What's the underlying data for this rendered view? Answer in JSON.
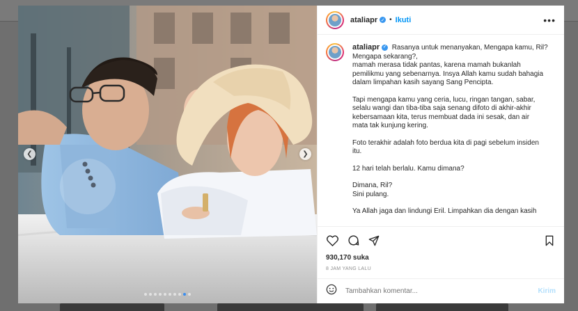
{
  "post": {
    "username": "ataliapr",
    "follow_label": "Ikuti",
    "caption_lines": [
      "Rasanya untuk menanyakan, Mengapa kamu, Ril?",
      "Mengapa sekarang?,",
      "mamah merasa tidak pantas, karena mamah bukanlah",
      "pemilikmu yang sebenarnya. Insya Allah kamu sudah bahagia",
      "dalam limpahan kasih sayang Sang Pencipta.",
      "",
      "Tapi mengapa kamu yang ceria, lucu, ringan tangan, sabar,",
      "selalu wangi dan tiba-tiba saja senang difoto di akhir-akhir",
      "kebersamaan kita, terus membuat dada ini sesak, dan air",
      "mata tak kunjung kering.",
      "",
      "Foto terakhir adalah foto berdua kita di pagi sebelum insiden",
      "itu.",
      "",
      "12 hari telah berlalu. Kamu dimana?",
      "",
      "Dimana, Ril?",
      "Sini pulang.",
      "",
      "Ya Allah jaga dan lindungi Eril. Limpahkan dia dengan kasih"
    ],
    "likes": "930,170 suka",
    "timestamp": "8 JAM YANG LALU",
    "comment_placeholder": "Tambahkan komentar...",
    "post_label": "Kirim",
    "carousel": {
      "total": 10,
      "active_index": 8
    }
  },
  "icons": {
    "heart": "heart-icon",
    "comment": "comment-icon",
    "share": "share-icon",
    "save": "bookmark-icon",
    "emoji": "emoji-icon",
    "more": "more-options-icon",
    "prev": "chevron-left-icon",
    "next": "chevron-right-icon"
  },
  "colors": {
    "accent": "#0095f6",
    "verified": "#3897f0",
    "muted": "#8e8e8e",
    "post_disabled": "#b2dffc"
  }
}
